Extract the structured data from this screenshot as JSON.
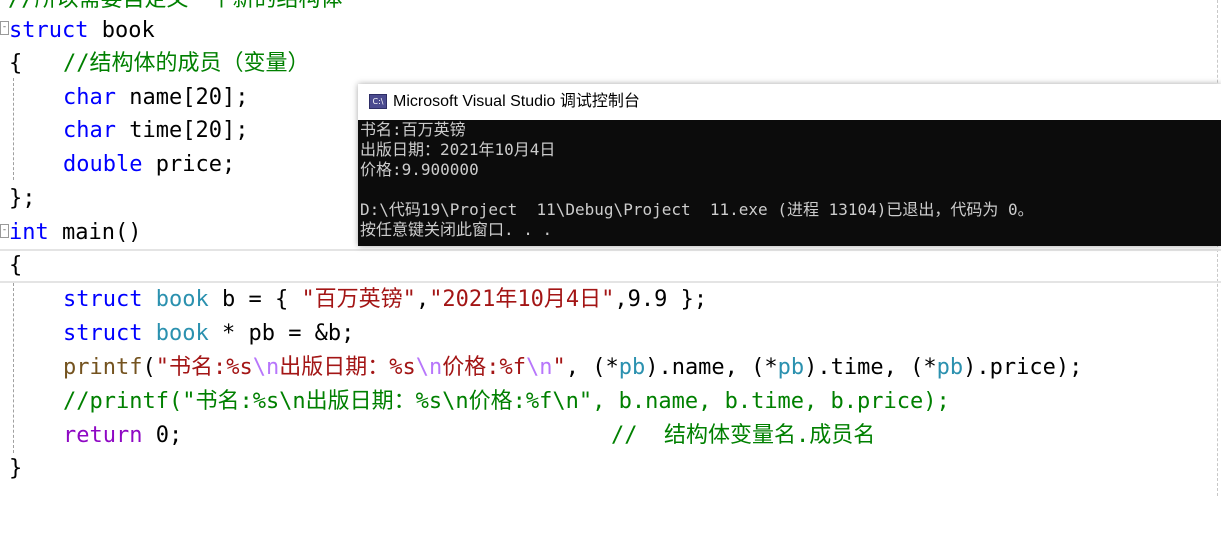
{
  "editor": {
    "top_comment": "//所以需要自定义一个新的结构体",
    "l_struct_kw": "struct",
    "l_struct_name": " book",
    "l_open_brace": "{",
    "l_member_comment": "//结构体的成员（变量）",
    "m1_type": "char",
    "m1_decl": " name[20];",
    "m2_type": "char",
    "m2_decl": " time[20];",
    "m3_type": "double",
    "m3_decl": " price;",
    "l_close_struct": "};",
    "main_kw": "int",
    "main_name": " main()",
    "main_open": "{",
    "s1_kw": "struct",
    "s1_type": " book",
    "s1_pre": " b = { ",
    "s1_str1": "\"百万英镑\"",
    "s1_comma": ",",
    "s1_str2": "\"2021年10月4日\"",
    "s1_tail": ",9.9 };",
    "s2_kw": "struct",
    "s2_type": " book",
    "s2_tail": " * pb = &b;",
    "p_fn": "printf",
    "p_paren": "(",
    "p_s1": "\"书名:%s",
    "p_e1": "\\n",
    "p_s2": "出版日期：%s",
    "p_e2": "\\n",
    "p_s3": "价格:%f",
    "p_e3": "\\n",
    "p_s4": "\"",
    "p_tail1": ", (*",
    "p_pb1": "pb",
    "p_tail2": ").name, (*",
    "p_pb2": "pb",
    "p_tail3": ").time, (*",
    "p_pb3": "pb",
    "p_tail4": ").price);",
    "c_line": "//printf(\"书名:%s\\n出版日期：%s\\n价格:%f\\n\", b.name, b.time, b.price);",
    "r_kw": "return",
    "r_val": " 0;",
    "r_comment": "//  结构体变量名.成员名",
    "main_close": "}"
  },
  "console": {
    "title": "Microsoft Visual Studio 调试控制台",
    "icon_label": "C:\\",
    "lines": [
      "书名:百万英镑",
      "出版日期：2021年10月4日",
      "价格:9.900000",
      "",
      "D:\\代码19\\Project  11\\Debug\\Project  11.exe (进程 13104)已退出，代码为 0。",
      "按任意键关闭此窗口. . ."
    ]
  }
}
